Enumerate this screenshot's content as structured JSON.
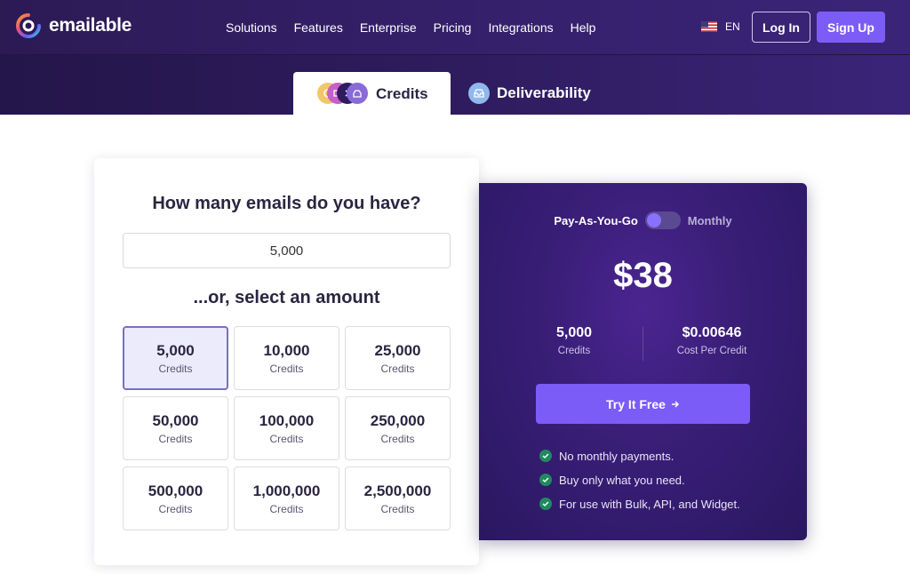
{
  "brand": {
    "name": "emailable"
  },
  "nav": {
    "items": [
      "Solutions",
      "Features",
      "Enterprise",
      "Pricing",
      "Integrations",
      "Help"
    ]
  },
  "header": {
    "language": "EN",
    "login_label": "Log In",
    "signup_label": "Sign Up"
  },
  "tabs": {
    "credits_label": "Credits",
    "deliverability_label": "Deliverability"
  },
  "calculator": {
    "question": "How many emails do you have?",
    "input_value": "5,000",
    "select_title": "...or, select an amount",
    "unit_label": "Credits",
    "options": [
      "5,000",
      "10,000",
      "25,000",
      "50,000",
      "100,000",
      "250,000",
      "500,000",
      "1,000,000",
      "2,500,000"
    ],
    "selected_option": "5,000"
  },
  "pricing": {
    "toggle_left": "Pay-As-You-Go",
    "toggle_right": "Monthly",
    "price": "$38",
    "credits_value": "5,000",
    "credits_label": "Credits",
    "cost_value": "$0.00646",
    "cost_label": "Cost Per Credit",
    "cta_label": "Try It Free",
    "features": [
      "No monthly payments.",
      "Buy only what you need.",
      "For use with Bulk, API, and Widget."
    ]
  },
  "colors": {
    "brand_purple": "#7c5cf6",
    "header_bg": "#2c1a55",
    "selected_bg": "#ecebfb",
    "check_green": "#1f8a5f"
  }
}
